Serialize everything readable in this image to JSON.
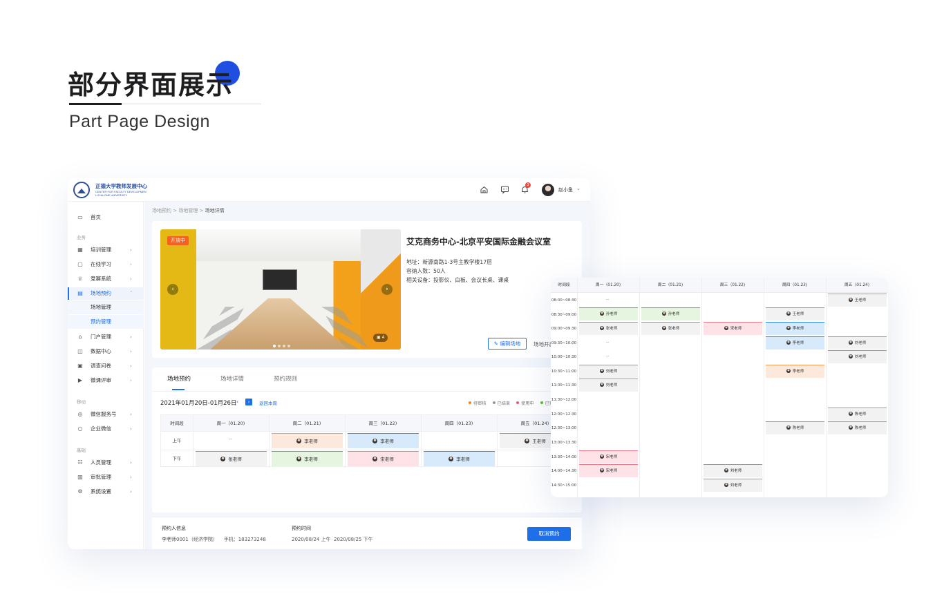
{
  "hero": {
    "title": "部分界面展示",
    "subtitle": "Part Page Design"
  },
  "colors": {
    "accent": "#1e6fe8",
    "hero_dot": "#1f4fe0",
    "open_tag": "#f5611e",
    "orange": "#f5a05a",
    "green": "#52c41a",
    "red": "#f07a8a",
    "blue": "#2d8de8",
    "gray": "#999999"
  },
  "topbar": {
    "logo_cn": "正德大学教师发展中心",
    "logo_en_1": "CENTER FOR FACULTY DEVELOPMEN",
    "logo_en_2": "LOYALONE UNIVERSITY",
    "notif_count": "3",
    "username": "赵小鱼",
    "icons": [
      "home-icon",
      "message-icon",
      "bell-icon",
      "chevron-down-icon"
    ]
  },
  "sidebar": {
    "home": "首页",
    "sec_business": "业务",
    "sec_portal": "移动",
    "sec_base": "基础",
    "items": [
      "培训管理",
      "在线学习",
      "竞赛系统",
      "场地预约",
      "门户管理",
      "数据中心",
      "调查问卷",
      "微课评审",
      "微信服务号",
      "企业微信",
      "人员管理",
      "审批管理",
      "系统设置"
    ],
    "sub_items": [
      "场地管理",
      "预约管理"
    ]
  },
  "breadcrumb": {
    "a": "场地预约",
    "sep1": " > ",
    "b": "场地管理",
    "sep2": " > ",
    "c": "场地详情"
  },
  "venue": {
    "status": "开放中",
    "title": "艾克商务中心-北京平安国际金融会议室",
    "address": "地址：新源南路1-3号主教学楼17层",
    "capacity": "容纳人数：50人",
    "equipment": "相关设备：投影仪、白板、会议长桌、课桌",
    "photo_count": "4",
    "edit_label": "编辑场地",
    "more_label": "场地开启"
  },
  "tabs": [
    "场地预约",
    "场地详情",
    "预约规则"
  ],
  "schedule": {
    "range": "2021年01月20日-01月26日",
    "back_week": "返回本周",
    "legend": [
      "待审核",
      "已结束",
      "使用中",
      "已预约"
    ],
    "headers": [
      "时间段",
      "周一（01.20)",
      "周二（01.21)",
      "周三（01.22)",
      "周四（01.23)",
      "周五（01.24)"
    ],
    "rows": [
      "上午",
      "下午"
    ],
    "dash": "--",
    "cells": {
      "am_tue": "李老师",
      "am_wed": "李老师",
      "am_fri": "王老师",
      "pm_mon": "张老师",
      "pm_tue": "李老师",
      "pm_wed": "宋老师",
      "pm_thu": "李老师"
    }
  },
  "footer": {
    "booker_label": "预约人信息",
    "booker": "李老师0001（经济学院）    手机：183273248",
    "time_label": "预约时间",
    "time": "2020/08/24 上午  2020/08/25 下午",
    "cancel": "取消预约"
  },
  "calendar": {
    "headers": [
      "时间段",
      "周一（01.20)",
      "周二（01.21)",
      "周三（01.22)",
      "周四（01.23)",
      "周五（01.24)"
    ],
    "times": [
      "08:00~08:30",
      "08:30~09:00",
      "09:00~09:30",
      "09:30~10:00",
      "10:00~10:30",
      "10:30~11:00",
      "11:00~11:30",
      "11:30~12:00",
      "12:00~12:30",
      "12:30~13:00",
      "13:00~13:30",
      "13:30~14:00",
      "14:00~14:30",
      "14:30~15:00"
    ],
    "dash": "--",
    "names": {
      "sun": "孙老师",
      "zhang": "张老师",
      "song": "宋老师",
      "wang": "王老师",
      "li": "李老师",
      "liu": "刘老师",
      "chen": "陈老师"
    }
  }
}
